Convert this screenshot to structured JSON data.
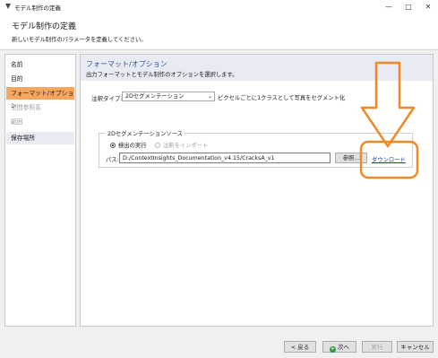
{
  "window": {
    "title": "モデル制作の定義"
  },
  "header": {
    "title": "モデル制作の定義",
    "subtitle": "新しいモデル制作のパラメータを定義してください。"
  },
  "sidebar": {
    "items": [
      {
        "label": "名前"
      },
      {
        "label": "目的"
      },
      {
        "label": "フォーマット/オプション"
      },
      {
        "label": "空間参照系"
      },
      {
        "label": "範囲"
      },
      {
        "label": "保存場所"
      }
    ]
  },
  "main": {
    "title": "フォーマット/オプション",
    "subtitle": "出力フォーマットとモデル制作のオプションを選択します。",
    "annotation_type_label": "注釈タイプ:",
    "annotation_type_value": "2Dセグメンテーション",
    "annotation_type_desc": "ピクセルごとに1クラスとして写真をセグメント化",
    "source_group_label": "2Dセグメンテーションソース",
    "radio_detect": "検出の実行",
    "radio_import": "注釈をインポート",
    "path_label": "パス:",
    "path_value": "D:/ContextInsights_Documentation_v4.15/CracksA_v1",
    "browse_label": "参照...",
    "download_label": "ダウンロード"
  },
  "footer": {
    "back_label": "< 戻る",
    "next_label": "次へ",
    "run_label": "実行",
    "cancel_label": "キャンセル"
  },
  "colors": {
    "highlight": "#f7a65f",
    "annotation": "#f08a24",
    "link": "#1a3f9a",
    "title_blue": "#2f5597"
  }
}
